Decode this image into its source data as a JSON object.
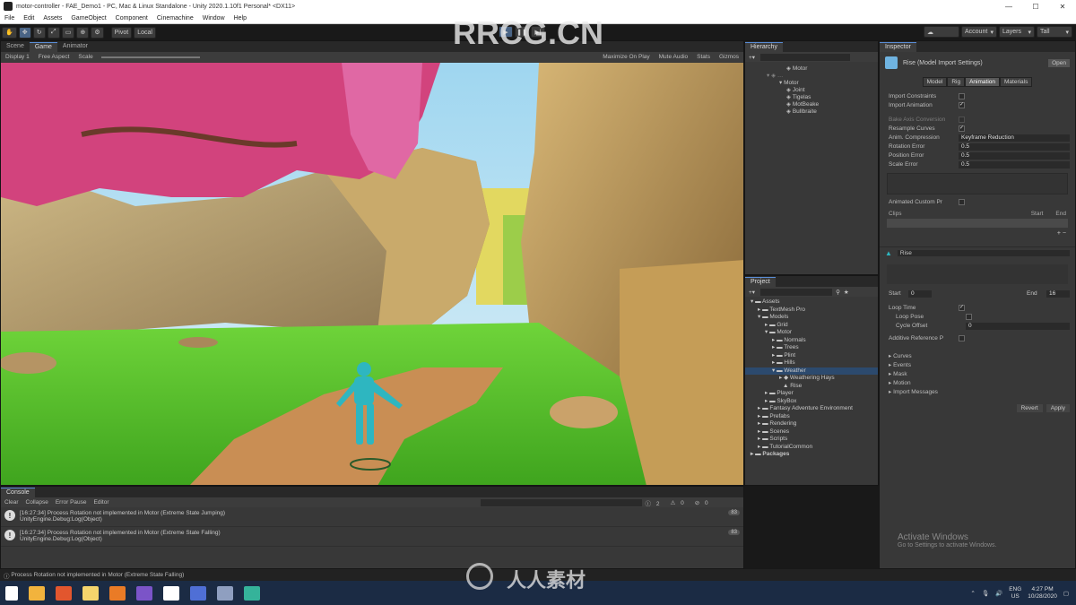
{
  "window": {
    "title": "motor-controller - FAE_Demo1 - PC, Mac & Linux Standalone - Unity 2020.1.10f1 Personal* <DX11>"
  },
  "menu": [
    "File",
    "Edit",
    "Assets",
    "GameObject",
    "Component",
    "Cinemachine",
    "Window",
    "Help"
  ],
  "toolbar": {
    "pivot": "Pivot",
    "local": "Local",
    "account": "Account",
    "layers": "Layers",
    "layout": "Tall"
  },
  "game_view": {
    "tabs": [
      "Scene",
      "Game",
      "Animator"
    ],
    "display": "Display 1",
    "aspect": "Free Aspect",
    "scale_label": "Scale",
    "options": [
      "Maximize On Play",
      "Mute Audio",
      "Stats",
      "Gizmos"
    ]
  },
  "hierarchy": {
    "tab": "Hierarchy",
    "root": "Motor",
    "items": [
      "Motor",
      "Joint",
      "Tigelas",
      "MotBeake",
      "Bullbraite"
    ]
  },
  "project": {
    "tab": "Project",
    "items": [
      "Assets",
      "TextMesh Pro",
      "Models",
      "Grid",
      "Motor",
      "Normals",
      "Trees",
      "Plint",
      "Hills",
      "Weather",
      "Weathering Hays",
      "Rise",
      "Player",
      "SkyBox",
      "Fantasy Adventure Environment",
      "Prefabs",
      "Rendering",
      "Scenes",
      "Scripts",
      "TutorialCommon",
      "Packages"
    ]
  },
  "inspector": {
    "tab": "Inspector",
    "title": "Rise (Model Import Settings)",
    "open_button": "Open",
    "subtabs": [
      "Model",
      "Rig",
      "Animation",
      "Materials"
    ],
    "fields": [
      {
        "label": "Import Constraints",
        "value": ""
      },
      {
        "label": "Import Animation",
        "value": "✓"
      },
      {
        "label": "Bake Axis Conversion",
        "value": ""
      },
      {
        "label": "Resample Curves",
        "value": "✓"
      },
      {
        "label": "Anim. Compression",
        "value": "Keyframe Reduction"
      },
      {
        "label": "Rotation Error",
        "value": "0.5"
      },
      {
        "label": "Position Error",
        "value": "0.5"
      },
      {
        "label": "Scale Error",
        "value": "0.5"
      }
    ],
    "clips_header": "Animated Custom Pr",
    "clip_columns": [
      "Clips",
      "Start",
      "End"
    ],
    "clip_name": "Rise",
    "start_label": "Start",
    "start_value": "0",
    "end_label": "End",
    "end_value": "16",
    "loop_fields": [
      "Loop Time",
      "Loop Pose",
      "Cycle Offset",
      "Additive Reference P"
    ],
    "sections": [
      "Curves",
      "Events",
      "Mask",
      "Motion",
      "Import Messages"
    ],
    "revert": "Revert",
    "apply": "Apply",
    "activate_title": "Activate Windows",
    "activate_sub": "Go to Settings to activate Windows."
  },
  "console": {
    "tab": "Console",
    "toolbar": [
      "Clear",
      "Collapse",
      "Error Pause",
      "Editor"
    ],
    "counts": [
      "2",
      "0",
      "0"
    ],
    "logs": [
      {
        "text": "[16:27:34] Process Rotation not implemented in Motor (Extreme State Jumping)",
        "sub": "UnityEngine.Debug:Log(Object)",
        "count": "83"
      },
      {
        "text": "[16:27:34] Process Rotation not implemented in Motor (Extreme State Falling)",
        "sub": "UnityEngine.Debug:Log(Object)",
        "count": "83"
      }
    ]
  },
  "status": "Process Rotation not implemented in Motor (Extreme State Falling)",
  "taskbar": {
    "lang": "ENG",
    "region": "US",
    "time": "4:27 PM",
    "date": "10/28/2020"
  },
  "watermarks": {
    "main": "RRCG.CN",
    "cn": "人人素材"
  }
}
